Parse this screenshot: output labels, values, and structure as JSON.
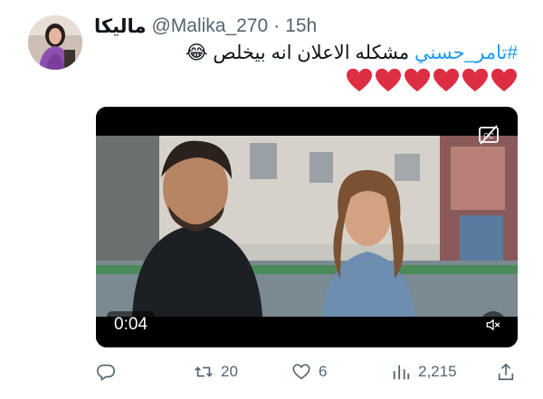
{
  "tweet": {
    "display_name": "ماليكا",
    "handle": "@Malika_270",
    "separator": "·",
    "time": "15h",
    "hashtag": "#تامر_حسني",
    "text": " مشكله الاعلان انه بيخلص",
    "emoji": "😂",
    "hearts": [
      "❤️",
      "❤️",
      "❤️",
      "❤️",
      "❤️",
      "❤️"
    ]
  },
  "video": {
    "duration": "0:04",
    "caption_icon": "closed-captions-off-icon",
    "mute_icon": "muted-speaker-icon"
  },
  "actions": {
    "reply_icon": "reply-icon",
    "reply_count": "",
    "retweet_icon": "retweet-icon",
    "retweet_count": "20",
    "like_icon": "heart-icon",
    "like_count": "6",
    "views_icon": "views-chart-icon",
    "views_count": "2,215",
    "share_icon": "share-icon"
  },
  "colors": {
    "hashtag": "#1d9bf0",
    "secondary_text": "#536471",
    "heart_red": "#dd2e44"
  }
}
